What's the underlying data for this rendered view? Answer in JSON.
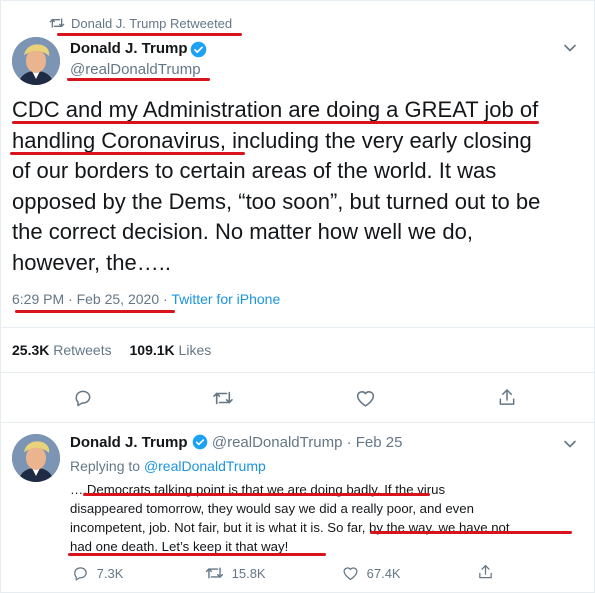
{
  "retweet_banner": {
    "text": "Donald J. Trump Retweeted"
  },
  "main_tweet": {
    "author_name": "Donald J. Trump",
    "handle": "@realDonaldTrump",
    "lines": [
      "CDC and my Administration are doing a GREAT job of",
      "handling Coronavirus, including the very early closing",
      "of our borders to certain areas of the world. It was",
      "opposed by the Dems, “too soon”, but turned out to be",
      "the correct decision. No matter how well we do,",
      "however, the….."
    ],
    "time": "6:29 PM",
    "sep1": "·",
    "date": "Feb 25, 2020",
    "sep2": "·",
    "source": "Twitter for iPhone",
    "retweets_count": "25.3K",
    "retweets_label": "Retweets",
    "likes_count": "109.1K",
    "likes_label": "Likes"
  },
  "reply_tweet": {
    "author_name": "Donald J. Trump",
    "handle": "@realDonaldTrump",
    "sep": "·",
    "date": "Feb 25",
    "replying_prefix": "Replying to",
    "replying_handle": "@realDonaldTrump",
    "lines": [
      "….Democrats talking point is that we are doing badly. If the virus",
      "disappeared tomorrow, they would say we did a really poor, and even",
      "incompetent, job. Not fair, but it is what it is. So far, by the way, we have not",
      "had one death. Let’s keep it that way!"
    ],
    "reply_count": "7.3K",
    "retweet_count": "15.8K",
    "like_count": "67.4K"
  },
  "colors": {
    "accent": "#1da1f2",
    "muted": "#657786",
    "text": "#14171a",
    "annotation": "#d8131c"
  },
  "icons": [
    "retweet-icon",
    "verified-badge-icon",
    "chevron-down-icon",
    "reply-icon",
    "like-icon",
    "share-icon"
  ]
}
